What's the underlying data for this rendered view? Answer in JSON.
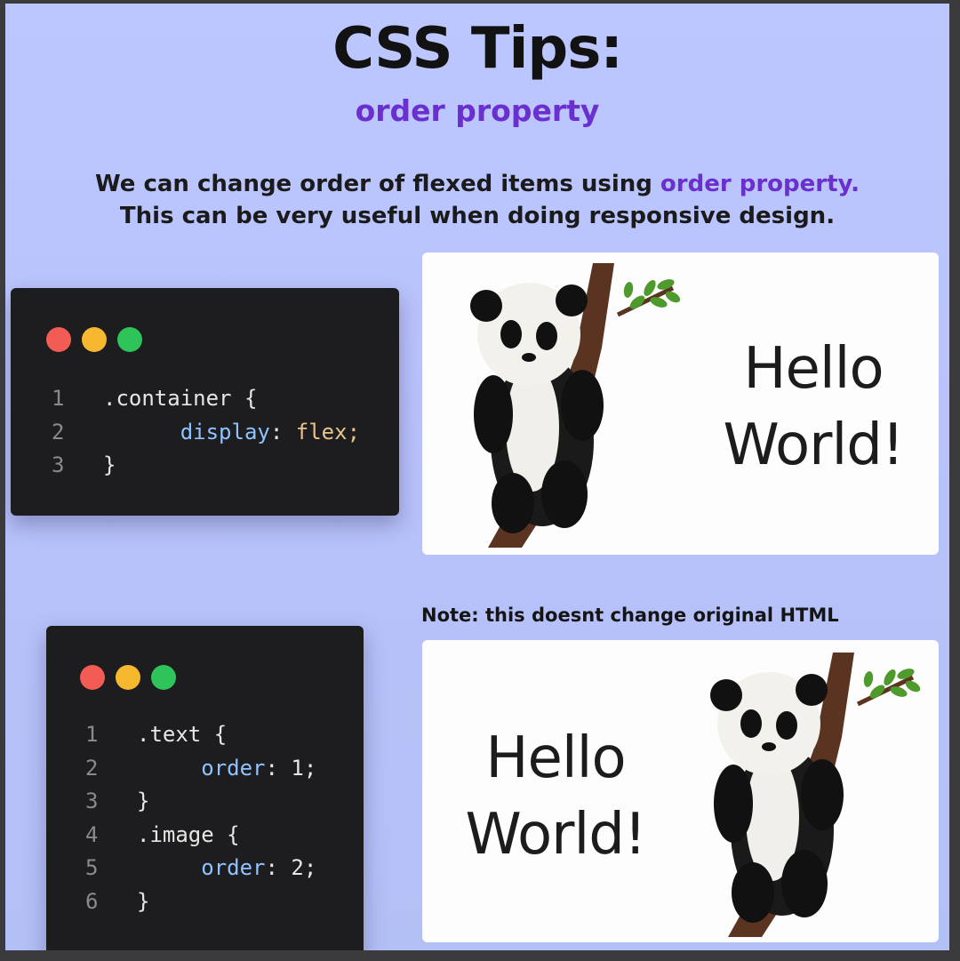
{
  "title": "CSS Tips:",
  "subtitle": "order property",
  "description": {
    "line1_prefix": "We can change order of flexed items using ",
    "line1_highlight": "order property.",
    "line2": "This can be very useful when doing responsive design."
  },
  "window_dots": [
    "#f25c54",
    "#f5b82e",
    "#2ec45a"
  ],
  "accent_color": "#6b2fcf",
  "example1": {
    "code": [
      {
        "num": "1",
        "text": ".container {"
      },
      {
        "num": "2",
        "prop": "display",
        "value": "flex;"
      },
      {
        "num": "3",
        "text": "}"
      }
    ],
    "hello_line1": "Hello",
    "hello_line2": "World!"
  },
  "note": "Note: this doesnt change original HTML",
  "example2": {
    "code": [
      {
        "num": "1",
        "text": ".text {"
      },
      {
        "num": "2",
        "prop": "order",
        "value": "1;"
      },
      {
        "num": "3",
        "text": "}"
      },
      {
        "num": "4",
        "text": ".image {"
      },
      {
        "num": "5",
        "prop": "order",
        "value": "2;"
      },
      {
        "num": "6",
        "text": "}"
      }
    ],
    "hello_line1": "Hello",
    "hello_line2": "World!"
  },
  "images": {
    "panda_icon": "panda-on-tree-icon"
  }
}
